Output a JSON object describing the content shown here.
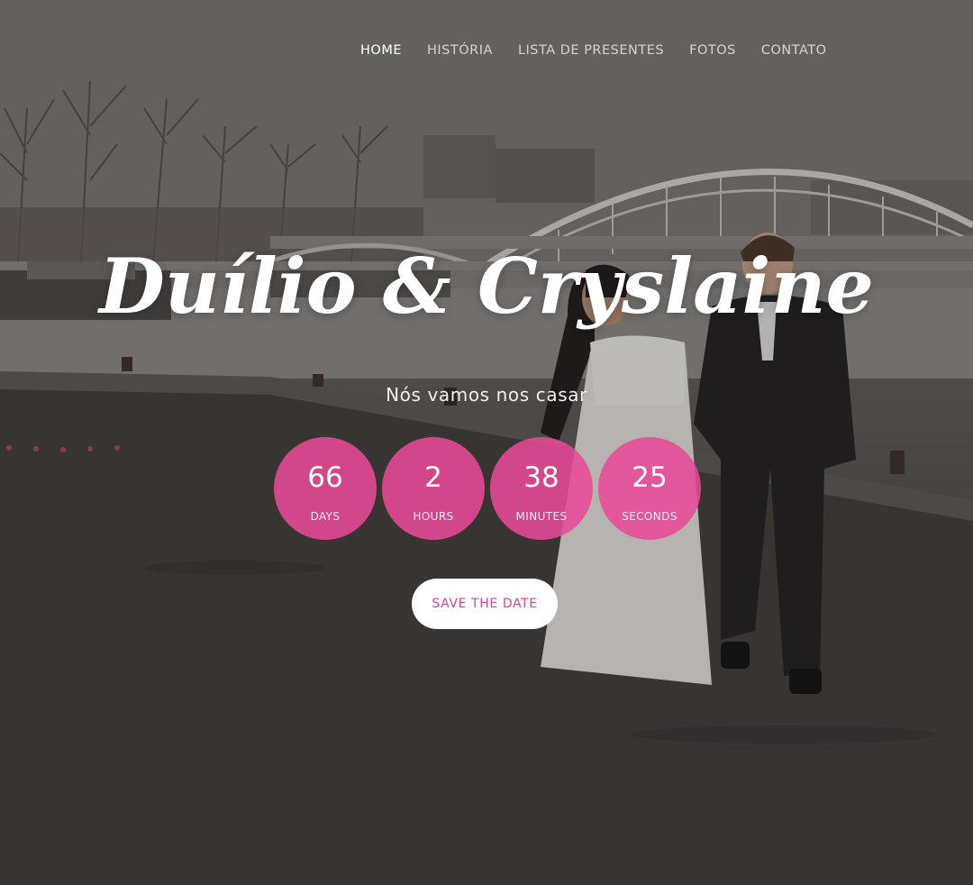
{
  "nav": {
    "items": [
      {
        "label": "HOME",
        "active": true
      },
      {
        "label": "HISTÓRIA",
        "active": false
      },
      {
        "label": "LISTA DE PRESENTES",
        "active": false
      },
      {
        "label": "FOTOS",
        "active": false
      },
      {
        "label": "CONTATO",
        "active": false
      }
    ]
  },
  "hero": {
    "title": "Duílio & Cryslaine",
    "subtitle": "Nós vamos nos casar",
    "countdown": [
      {
        "value": "66",
        "unit": "DAYS"
      },
      {
        "value": "2",
        "unit": "HOURS"
      },
      {
        "value": "38",
        "unit": "MINUTES"
      },
      {
        "value": "25",
        "unit": "SECONDS"
      }
    ],
    "cta_label": "SAVE THE DATE"
  },
  "colors": {
    "accent": "#e84a97",
    "cta_text": "#d9468f",
    "nav_text": "#d7d3cf",
    "nav_active": "#ffffff"
  }
}
